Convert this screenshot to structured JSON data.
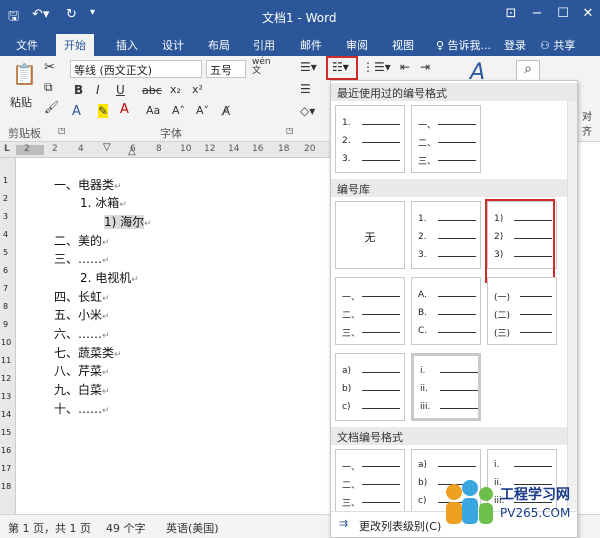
{
  "window": {
    "title": "文档1 - Word",
    "min": "−",
    "max": "☐",
    "close": "✕",
    "ribbon_opt": "⊡"
  },
  "tabs": [
    {
      "label": "文件"
    },
    {
      "label": "开始"
    },
    {
      "label": "插入"
    },
    {
      "label": "设计"
    },
    {
      "label": "布局"
    },
    {
      "label": "引用"
    },
    {
      "label": "邮件"
    },
    {
      "label": "审阅"
    },
    {
      "label": "视图"
    }
  ],
  "tellme": "♀ 告诉我...",
  "login": "登录",
  "share": "共享",
  "ribbon": {
    "paste": "粘贴",
    "font_name": "等线 (西文正文)",
    "font_size": "五号",
    "wen": "wén\n文",
    "bold": "B",
    "italic": "I",
    "underline": "U",
    "strike": "abc",
    "sub": "x₂",
    "sup": "x²",
    "fontcolor": "A",
    "case": "Aa",
    "grow": "A˄",
    "shrink": "A˅",
    "clipboard": "剪贴板",
    "font_group": "字体",
    "styles_btn": "A",
    "find_icon": "⌕",
    "partial_right": "对齐"
  },
  "ruler_ticks": [
    "2",
    "2",
    "4",
    "6",
    "8",
    "10",
    "12",
    "14",
    "16",
    "18",
    "20"
  ],
  "ruler_marker": "L",
  "vruler_ticks": [
    "1",
    "2",
    "3",
    "4",
    "5",
    "6",
    "7",
    "8",
    "9",
    "10",
    "11",
    "12",
    "13",
    "14",
    "15",
    "16",
    "17",
    "18"
  ],
  "doc_lines": [
    "一、电器类",
    "1.    冰箱",
    "1)    海尔",
    "二、美的",
    "三、……",
    "2.    电视机",
    "四、长虹",
    "五、小米",
    "六、……",
    "七、蔬菜类",
    "八、芹菜",
    "九、白菜",
    "十、……"
  ],
  "pilcrow": "↵",
  "status": {
    "page": "第 1 页，共 1 页",
    "words": "49 个字",
    "lang": "英语(美国)"
  },
  "panel": {
    "recent_title": "最近使用过的编号格式",
    "library_title": "编号库",
    "doc_title": "文档编号格式",
    "none_label": "无",
    "footer": "更改列表级别(C)",
    "recent": [
      [
        "1.",
        "2.",
        "3."
      ],
      [
        "一、",
        "二、",
        "三、"
      ]
    ],
    "library": [
      [
        "1.",
        "2.",
        "3."
      ],
      [
        "1)",
        "2)",
        "3)"
      ],
      [
        "一、",
        "二、",
        "三、"
      ],
      [
        "A.",
        "B.",
        "C."
      ],
      [
        "(一)",
        "(二)",
        "(三)"
      ],
      [
        "a)",
        "b)",
        "c)"
      ],
      [
        "i.",
        "ii.",
        "iii."
      ]
    ],
    "document": [
      [
        "一、",
        "二、",
        "三、"
      ],
      [
        "a)",
        "b)",
        "c)"
      ],
      [
        "i.",
        "ii.",
        "iii."
      ]
    ]
  },
  "watermark": {
    "line1": "工程学习网",
    "line2": "PV265.COM"
  }
}
